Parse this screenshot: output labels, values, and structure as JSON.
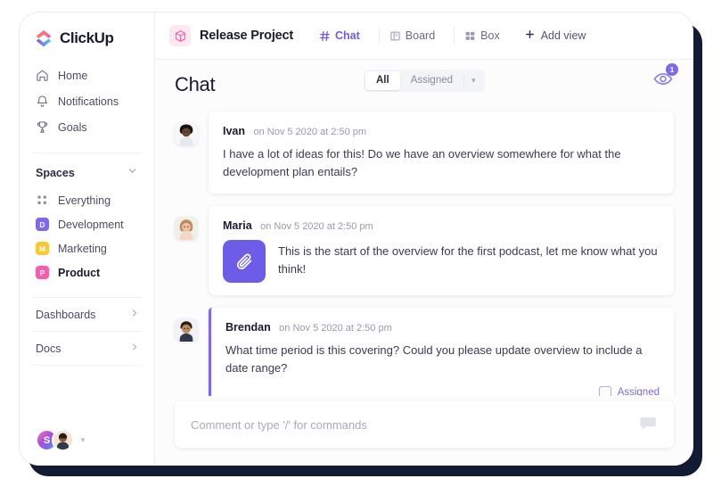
{
  "brand": {
    "name": "ClickUp",
    "logo_icon": "clickup-logo-icon"
  },
  "sidebar": {
    "nav": [
      {
        "label": "Home",
        "icon": "home-icon"
      },
      {
        "label": "Notifications",
        "icon": "bell-icon"
      },
      {
        "label": "Goals",
        "icon": "trophy-icon"
      }
    ],
    "spaces_section": {
      "title": "Spaces",
      "collapse_icon": "chevron-down-icon",
      "items": [
        {
          "label": "Everything",
          "icon": "grid-dots-icon",
          "initial": "",
          "color": ""
        },
        {
          "label": "Development",
          "icon": "space-square-icon",
          "initial": "D",
          "color": "#7b68ee"
        },
        {
          "label": "Marketing",
          "icon": "space-square-icon",
          "initial": "M",
          "color": "#fdc730"
        },
        {
          "label": "Product",
          "icon": "space-square-icon",
          "initial": "P",
          "color": "#f85dad",
          "active": true
        }
      ]
    },
    "links": [
      {
        "label": "Dashboards",
        "icon": "chevron-right-icon"
      },
      {
        "label": "Docs",
        "icon": "chevron-right-icon"
      }
    ],
    "footer": {
      "workspace_initial": "S",
      "avatar_icon": "user-avatar",
      "caret_icon": "chevron-down-icon"
    }
  },
  "topbar": {
    "project_icon": "box-cube-icon",
    "project_name": "Release Project",
    "views": [
      {
        "label": "Chat",
        "icon": "hash-icon",
        "active": true
      },
      {
        "label": "Board",
        "icon": "board-icon",
        "active": false
      },
      {
        "label": "Box",
        "icon": "box-grid-icon",
        "active": false
      }
    ],
    "add_view": {
      "label": "Add view",
      "icon": "plus-icon"
    }
  },
  "chat": {
    "title": "Chat",
    "filter": {
      "options": [
        "All",
        "Assigned"
      ],
      "selected": "All",
      "chevron_icon": "chevron-down-icon"
    },
    "watchers": {
      "icon": "eye-icon",
      "count": "1"
    },
    "messages": [
      {
        "author": "Ivan",
        "time": "on Nov 5 2020 at 2:50 pm",
        "text": "I have a lot of ideas for this! Do we have an overview somewhere for what the development plan entails?",
        "avatar_icon": "user-avatar-ivan"
      },
      {
        "author": "Maria",
        "time": "on Nov 5 2020 at 2:50 pm",
        "text": "This is the start of the overview for the first podcast, let me know what you think!",
        "avatar_icon": "user-avatar-maria",
        "attachment_icon": "paperclip-icon"
      },
      {
        "author": "Brendan",
        "time": "on Nov 5 2020 at 2:50 pm",
        "text": "What time period is this covering? Could you please update overview to include a date range?",
        "avatar_icon": "user-avatar-brendan",
        "assigned_label": "Assigned",
        "assigned_checked": false
      }
    ],
    "composer": {
      "placeholder": "Comment or type '/' for commands",
      "value": "",
      "icon": "comment-bubble-icon"
    }
  },
  "colors": {
    "accent_purple": "#7b68ee",
    "attachment_purple": "#6c5ce7",
    "badge_purple": "#7b68ee",
    "project_pink": "#f85dad",
    "space_marketing": "#fdc730",
    "window_shadow": "#131a34"
  }
}
